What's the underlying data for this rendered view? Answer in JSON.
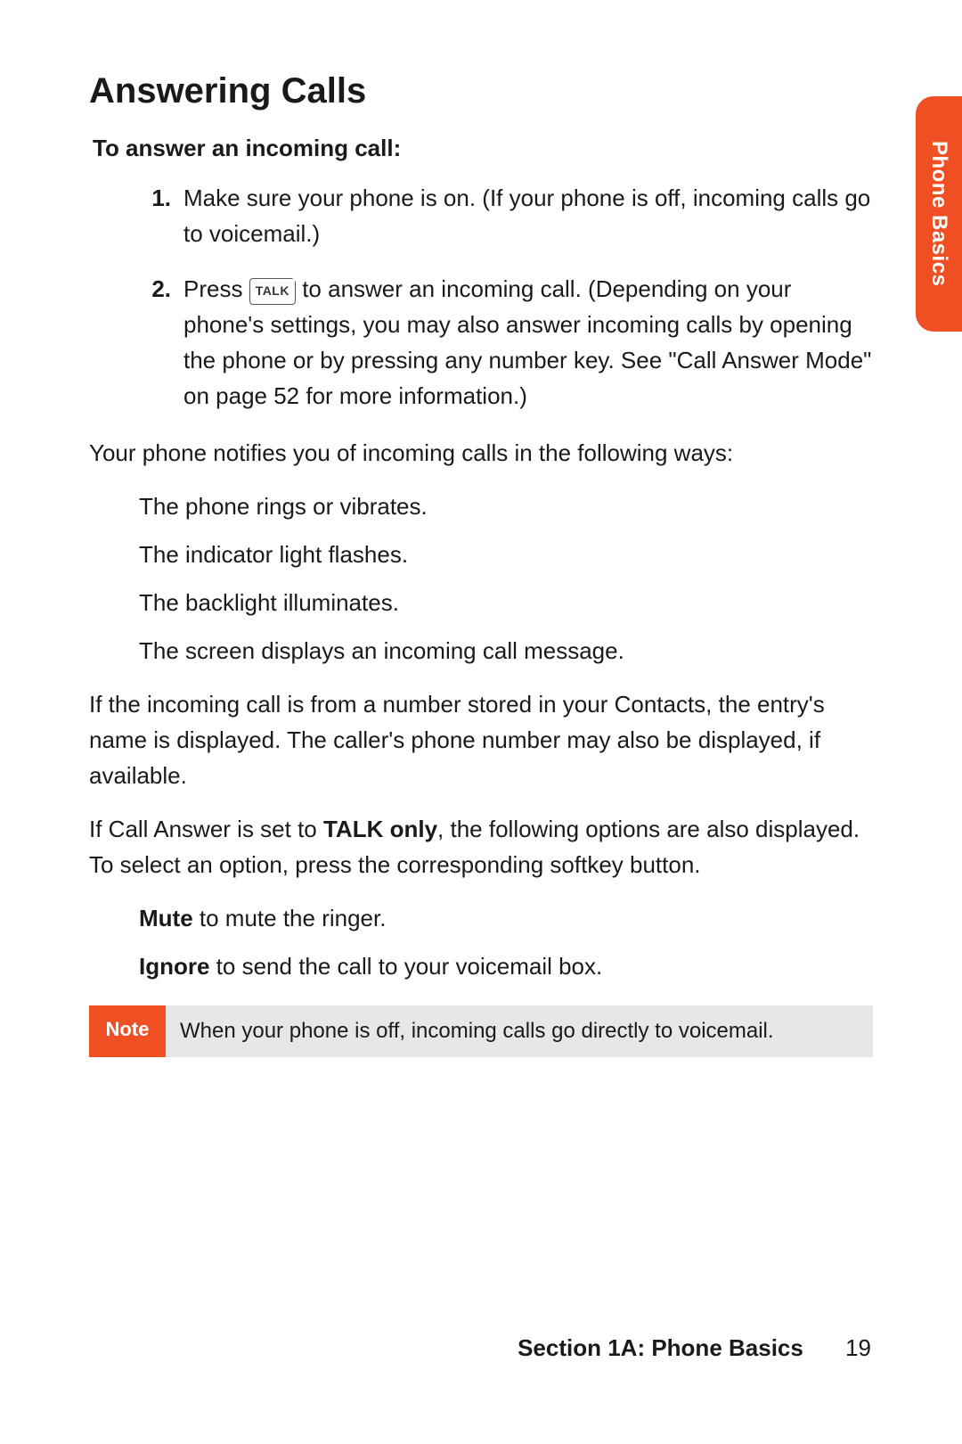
{
  "tab_label": "Phone Basics",
  "heading": "Answering Calls",
  "subheading": "To answer an incoming call:",
  "steps": [
    {
      "num": "1.",
      "text": "Make sure your phone is on. (If your phone is off, incoming calls go to voicemail.)"
    },
    {
      "num": "2.",
      "pre": "Press ",
      "key": "TALK",
      "post": " to answer an incoming call. (Depending on your phone's settings, you may also answer incoming calls by opening the phone or by pressing any number key. See \"Call Answer Mode\" on page 52 for more information.)"
    }
  ],
  "notify_intro": "Your phone notifies you of incoming calls in the following ways:",
  "notify_items": [
    "The phone rings or vibrates.",
    "The indicator light flashes.",
    "The backlight illuminates.",
    "The screen displays an incoming call message."
  ],
  "contacts_para": "If the incoming call is from a number stored in your Contacts, the entry's name is displayed. The caller's phone number may also be displayed, if available.",
  "talkonly_pre": "If Call Answer is set to ",
  "talkonly_bold": "TALK only",
  "talkonly_post": ", the following options are also displayed. To select an option, press the corresponding softkey button.",
  "options": [
    {
      "bold": "Mute",
      "rest": " to mute the ringer."
    },
    {
      "bold": "Ignore",
      "rest": " to send the call to your voicemail box."
    }
  ],
  "note_label": "Note",
  "note_body": "When your phone is off, incoming calls go directly to voicemail.",
  "footer_section": "Section 1A: Phone Basics",
  "page_number": "19"
}
